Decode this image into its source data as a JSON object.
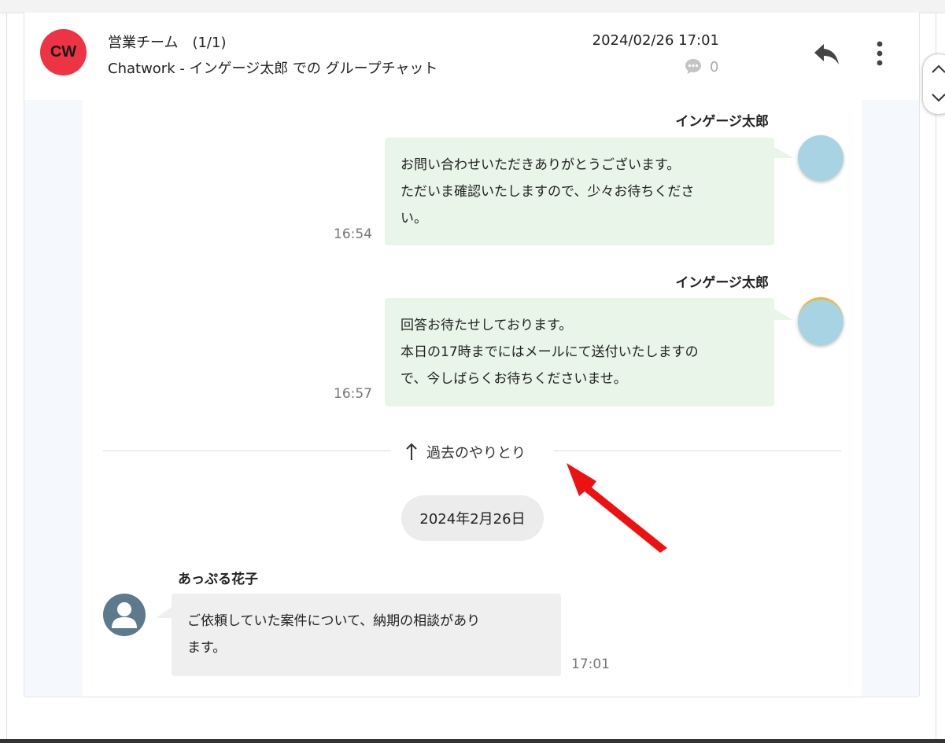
{
  "header": {
    "avatar_text": "CW",
    "avatar_color": "#ee3344",
    "title": "営業チーム　(1/1)",
    "subtitle": "Chatwork - インゲージ太郎 での グループチャット",
    "date": "2024/02/26 17:01",
    "comment_count": "0",
    "reply_icon": "reply-icon",
    "more_icon": "more-vertical-icon"
  },
  "messages": [
    {
      "sender": "インゲージ太郎",
      "text": "お問い合わせいただきありがとうございます。\nただいま確認いたしますので、少々お待ちくださ\nい。",
      "time": "16:54",
      "side": "right"
    },
    {
      "sender": "インゲージ太郎",
      "text": "回答お待たせしております。\n本日の17時までにはメールにて送付いたしますの\nで、今しばらくお待ちくださいませ。",
      "time": "16:57",
      "side": "right"
    }
  ],
  "history_link": {
    "label": "過去のやりとり",
    "icon": "arrow-up-icon"
  },
  "date_separator": "2024年2月26日",
  "incoming": {
    "sender": "あっぷる花子",
    "text": "ご依頼していた案件について、納期の相談があり\nます。",
    "time": "17:01"
  },
  "colors": {
    "my_bubble": "#e8f5e8",
    "their_bubble": "#efefef",
    "annotation_arrow": "#ee1111"
  }
}
